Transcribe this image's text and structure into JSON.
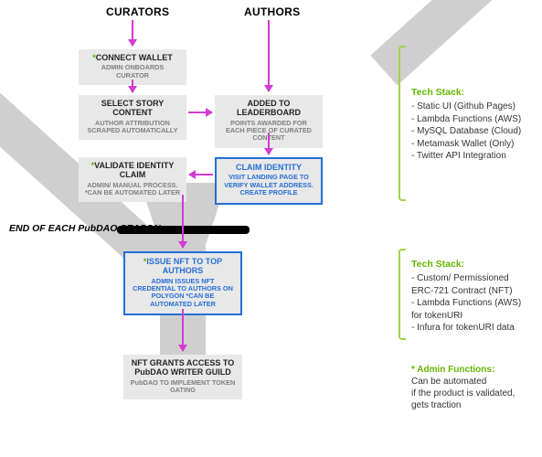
{
  "headers": {
    "curators": "CURATORS",
    "authors": "AUTHORS"
  },
  "season_label": "END OF EACH PubDAO SEASON",
  "boxes": {
    "connect_wallet": {
      "title": "CONNECT WALLET",
      "sub": "ADMIN ONBOARDS CURATOR",
      "star": "*"
    },
    "select_story": {
      "title": "SELECT STORY CONTENT",
      "sub": "AUTHOR ATTRIBUTION SCRAPED AUTOMATICALLY"
    },
    "added_leaderboard": {
      "title": "ADDED TO LEADERBOARD",
      "sub": "POINTS AWARDED FOR EACH PIECE OF CURATED CONTENT"
    },
    "validate_identity": {
      "title": "VALIDATE IDENTITY CLAIM",
      "sub": "ADMIN/ MANUAL PROCESS. *CAN BE AUTOMATED LATER",
      "star": "*"
    },
    "claim_identity": {
      "title": "CLAIM IDENTITY",
      "sub": "VISIT LANDING PAGE TO VERIFY WALLET ADDRESS. CREATE PROFILE"
    },
    "issue_nft": {
      "title": "ISSUE NFT TO TOP AUTHORS",
      "sub": "ADMIN ISSUES NFT CREDENTIAL TO  AUTHORS ON POLYGON *CAN BE AUTOMATED LATER",
      "star": "*"
    },
    "nft_grants": {
      "title": "NFT GRANTS ACCESS TO PubDAO WRITER GUILD",
      "sub": "PubDAO TO IMPLEMENT TOKEN GATING"
    }
  },
  "tech_stack_top": {
    "heading": "Tech Stack:",
    "items": [
      "- Static UI (Github Pages)",
      "- Lambda Functions (AWS)",
      "- MySQL Database (Cloud)",
      "- Metamask Wallet (Only)",
      "- Twitter API Integration"
    ]
  },
  "tech_stack_bottom": {
    "heading": "Tech Stack:",
    "items": [
      "- Custom/ Permissioned",
      "  ERC-721 Contract (NFT)",
      "- Lambda Functions (AWS)",
      "  for tokenURI",
      "- Infura for tokenURI data"
    ]
  },
  "admin_note": {
    "heading": "* Admin Functions:",
    "lines": [
      "Can be automated",
      "if the product is validated,",
      "gets traction"
    ]
  }
}
